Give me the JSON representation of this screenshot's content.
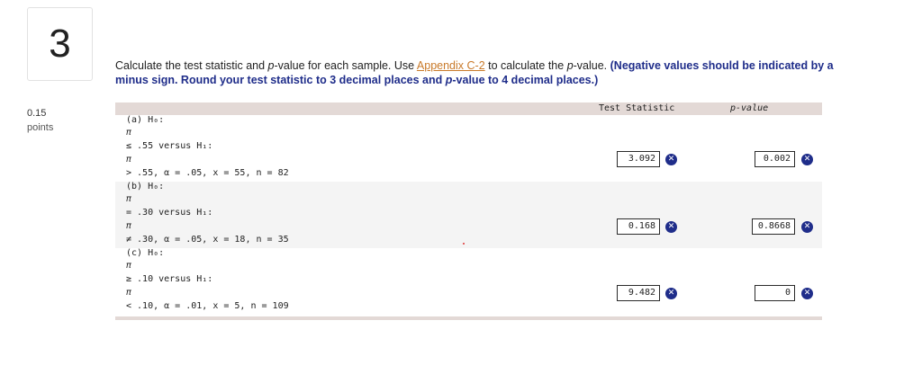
{
  "question": {
    "number": "3",
    "points_value": "0.15",
    "points_label": "points"
  },
  "prompt": {
    "before_link": "Calculate the test statistic and ",
    "p_italic": "p",
    "after_p": "-value for each sample. Use ",
    "link_text": "Appendix C-2",
    "after_link": " to calculate the ",
    "p_italic2": "p",
    "after_p2": "-value. ",
    "note": "(Negative values should be indicated by a minus sign. Round your test statistic to 3 decimal places and ",
    "note_p": "p",
    "note_end": "-value to 4 decimal places.)"
  },
  "table": {
    "headers": {
      "test_statistic": "Test Statistic",
      "p_value": "p-value"
    },
    "rows": [
      {
        "lines": [
          "(a) H₀:",
          "π",
          "≤ .55 versus H₁:",
          "π",
          "> .55, α = .05, x = 55, n = 82"
        ],
        "test_statistic": "3.092",
        "p_value": "0.002"
      },
      {
        "lines": [
          "(b) H₀:",
          "π",
          "= .30 versus H₁:",
          "π",
          "≠ .30, α = .05, x = 18, n = 35"
        ],
        "test_statistic": "0.168",
        "p_value": "0.8668"
      },
      {
        "lines": [
          "(c) H₀:",
          "π",
          "≥ .10 versus H₁:",
          "π",
          "< .10, α = .01, x = 5, n = 109"
        ],
        "test_statistic": "9.482",
        "p_value": "0"
      }
    ]
  },
  "icons": {
    "incorrect": "x-circle-icon"
  },
  "colors": {
    "accent": "#1f2d8a",
    "link": "#c97a2a",
    "header_bg": "#e3d9d6"
  }
}
